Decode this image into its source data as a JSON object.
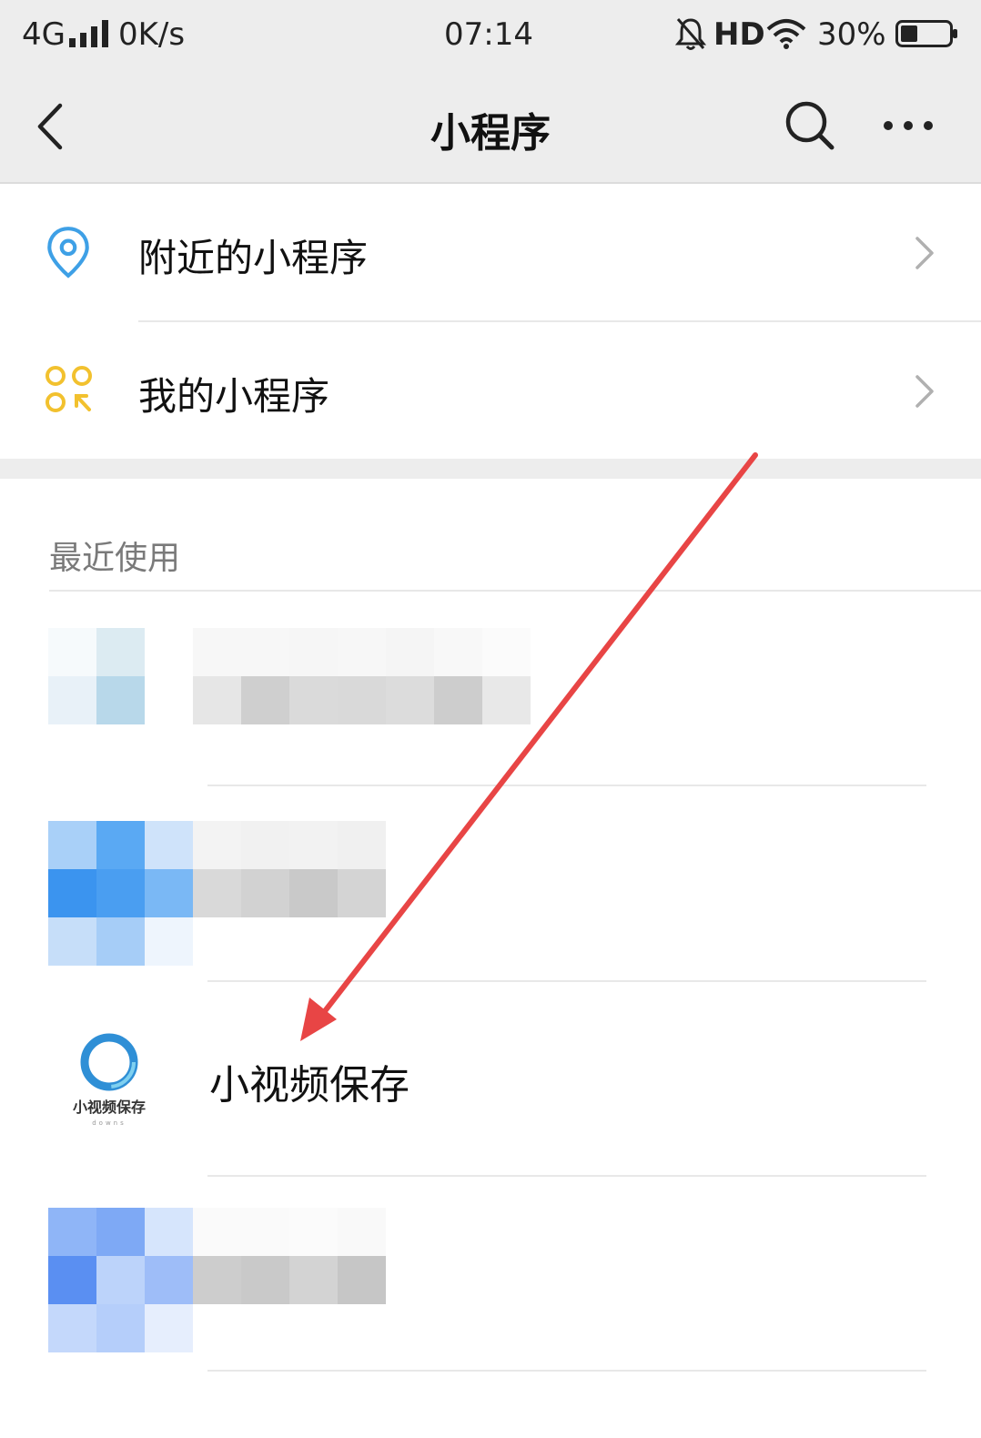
{
  "status_bar": {
    "network": "4G",
    "speed": "0K/s",
    "time": "07:14",
    "hd": "HD",
    "battery": "30%"
  },
  "nav": {
    "title": "小程序",
    "icons": [
      "back-icon",
      "search-icon",
      "more-icon"
    ]
  },
  "menu": {
    "nearby": "附近的小程序",
    "mine": "我的小程序"
  },
  "recent": {
    "section_title": "最近使用",
    "items": [
      {
        "name": "",
        "blurred": true
      },
      {
        "name": "",
        "blurred": true
      },
      {
        "name": "小视频保存",
        "blurred": false,
        "logo_caption": "小视频保存",
        "logo_sub": "downs"
      },
      {
        "name": "",
        "blurred": true
      }
    ]
  },
  "colors": {
    "accent_blue": "#3ea0e6",
    "accent_yellow": "#f2c12e",
    "arrow_red": "#e84545",
    "bar_bg": "#ededed"
  }
}
